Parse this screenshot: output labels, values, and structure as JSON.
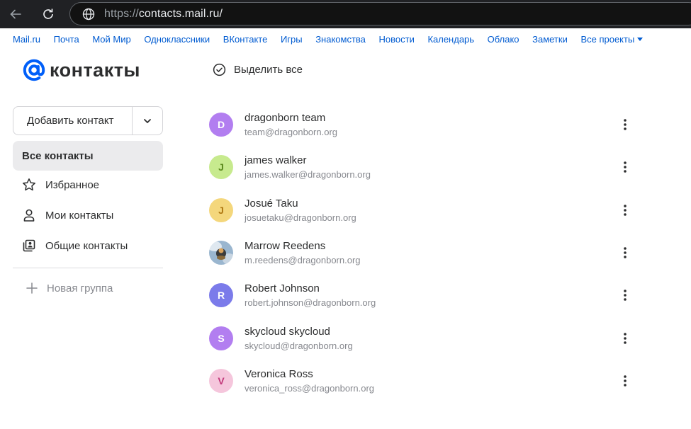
{
  "browser": {
    "url_protocol": "https://",
    "url_host": "contacts.mail.ru/"
  },
  "portal_nav": [
    {
      "label": "Mail.ru"
    },
    {
      "label": "Почта"
    },
    {
      "label": "Мой Мир"
    },
    {
      "label": "Одноклассники"
    },
    {
      "label": "ВКонтакте"
    },
    {
      "label": "Игры"
    },
    {
      "label": "Знакомства"
    },
    {
      "label": "Новости"
    },
    {
      "label": "Календарь"
    },
    {
      "label": "Облако"
    },
    {
      "label": "Заметки"
    },
    {
      "label": "Все проекты"
    }
  ],
  "logo": {
    "word": "контакты",
    "accent_color": "#005ff9"
  },
  "toolbar": {
    "select_all_label": "Выделить все"
  },
  "sidebar": {
    "add_contact_label": "Добавить контакт",
    "items": [
      {
        "label": "Все контакты",
        "icon": "none",
        "active": true
      },
      {
        "label": "Избранное",
        "icon": "star-icon"
      },
      {
        "label": "Мои контакты",
        "icon": "person-icon"
      },
      {
        "label": "Общие контакты",
        "icon": "shared-contacts-icon"
      }
    ],
    "new_group_label": "Новая группа"
  },
  "contacts": [
    {
      "initial": "D",
      "name": "dragonborn team",
      "email": "team@dragonborn.org",
      "avatar_color": "#b27ef0",
      "initial_color": "#ffffff"
    },
    {
      "initial": "J",
      "name": "james walker",
      "email": "james.walker@dragonborn.org",
      "avatar_color": "#c7ea8e",
      "initial_color": "#5c8a1e"
    },
    {
      "initial": "J",
      "name": "Josué Taku",
      "email": "josuetaku@dragonborn.org",
      "avatar_color": "#f4d77c",
      "initial_color": "#b07a14"
    },
    {
      "initial": "",
      "name": "Marrow Reedens",
      "email": "m.reedens@dragonborn.org",
      "avatar_color": "photo",
      "initial_color": "#ffffff"
    },
    {
      "initial": "R",
      "name": "Robert Johnson",
      "email": "robert.johnson@dragonborn.org",
      "avatar_color": "#7b7bea",
      "initial_color": "#ffffff"
    },
    {
      "initial": "S",
      "name": "skycloud skycloud",
      "email": "skycloud@dragonborn.org",
      "avatar_color": "#b27ef0",
      "initial_color": "#ffffff"
    },
    {
      "initial": "V",
      "name": "Veronica Ross",
      "email": "veronica_ross@dragonborn.org",
      "avatar_color": "#f5c6dc",
      "initial_color": "#c2387a"
    }
  ]
}
